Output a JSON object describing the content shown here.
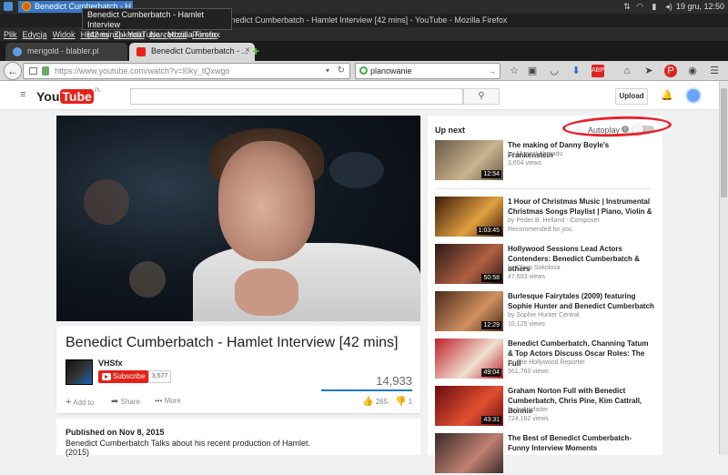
{
  "os": {
    "taskbar_title": "Benedict Cumberbatch - H",
    "clock": "19 gru, 12:50",
    "tray_icons": [
      "network-icon",
      "wifi-icon",
      "battery-icon",
      "volume-icon"
    ]
  },
  "window": {
    "title": "Benedict Cumberbatch - Hamlet Interview [42 mins] - YouTube - Mozilla Firefox",
    "tooltip_line1": "Benedict Cumberbatch - Hamlet Interview",
    "tooltip_line2": "[42 mins] - YouTube - Mozilla Firefox"
  },
  "menubar": [
    "Plik",
    "Edycja",
    "Widok",
    "Historia",
    "Zakładki",
    "Narzędzia",
    "Pomoc"
  ],
  "tabs": [
    {
      "label": "merigold - blabler.pl"
    },
    {
      "label": "Benedict Cumberbatch - ..."
    }
  ],
  "nav": {
    "url": "https://www.youtube.com/watch?v=l0ky_tQxwgo",
    "search_value": "planowanie"
  },
  "youtube": {
    "logo_you": "You",
    "logo_tube": "Tube",
    "logo_country": "PL",
    "upload_label": "Upload",
    "video_title": "Benedict Cumberbatch - Hamlet Interview [42 mins]",
    "channel_name": "VHSfx",
    "subscribe_label": "Subscribe",
    "subscriber_count": "3,577",
    "view_count": "14,933",
    "add_to_label": "Add to",
    "share_label": "Share",
    "more_label": "More",
    "likes": "265",
    "dislikes": "1",
    "published": "Published on Nov 8, 2015",
    "description": "Benedict Cumberbatch Talks about his recent production of Hamlet.",
    "description_year": "(2015)",
    "up_next_label": "Up next",
    "autoplay_label": "Autoplay",
    "autoplay_on": false
  },
  "recommendations": [
    {
      "title": "The making of Danny Boyle's Frankenstein",
      "by": "by Munirat Ahmadu",
      "views": "3,654 views",
      "duration": "12:54",
      "colors": [
        "#6a5a4a",
        "#c9b38c"
      ]
    },
    {
      "title": "1 Hour of Christmas Music | Instrumental Christmas Songs Playlist | Piano, Violin &",
      "by": "by Peder B. Helland - Composer",
      "views": "Recommended for you",
      "duration": "1:03:45",
      "colors": [
        "#3a1a0a",
        "#e0a040"
      ]
    },
    {
      "title": "Hollywood Sessions Lead Actors Contenders: Benedict Cumberbatch & others",
      "by": "by Olivia Sokolova",
      "views": "47,693 views",
      "duration": "50:58",
      "colors": [
        "#2a1a1a",
        "#b06040"
      ]
    },
    {
      "title": "Burlesque Fairytales (2009) featuring Sophie Hunter and Benedict Cumberbatch",
      "by": "by Sophie Hunter Central",
      "views": "10,125 views",
      "duration": "12:29",
      "colors": [
        "#4a2a1a",
        "#d09060"
      ]
    },
    {
      "title": "Benedict Cumberbatch, Channing Tatum & Top Actors Discuss Oscar Roles: The Full",
      "by": "by The Hollywood Reporter",
      "views": "561,763 views",
      "duration": "49:04",
      "colors": [
        "#c0202a",
        "#f0e0d0"
      ]
    },
    {
      "title": "Graham Norton Full with Benedict Cumberbatch, Chris Pine, Kim Cattrall, Bonnie",
      "by": "by fadingfader",
      "views": "724,182 views",
      "duration": "43:31",
      "colors": [
        "#6a0a10",
        "#e05030"
      ]
    },
    {
      "title": "The Best of Benedict Cumberbatch- Funny Interview Moments",
      "by": "",
      "views": "",
      "duration": "",
      "colors": [
        "#3a2a2a",
        "#c08070"
      ]
    }
  ]
}
